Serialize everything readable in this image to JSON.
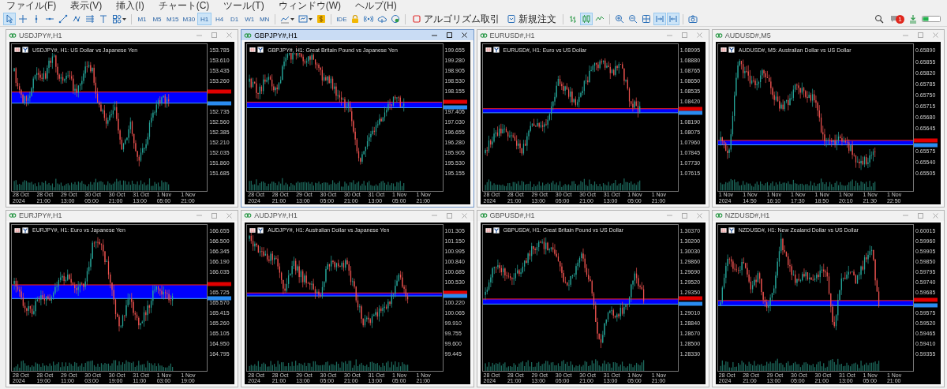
{
  "menu": [
    "ファイル(F)",
    "表示(V)",
    "挿入(I)",
    "チャート(C)",
    "ツール(T)",
    "ウィンドウ(W)",
    "ヘルプ(H)"
  ],
  "toolbar": {
    "drawing_tools": [
      {
        "kind": "cursor",
        "selected": true
      },
      {
        "kind": "crosshair",
        "selected": false
      },
      {
        "kind": "vertical-line",
        "selected": false
      },
      {
        "kind": "horizontal-line",
        "selected": false
      },
      {
        "kind": "trendline",
        "selected": false
      },
      {
        "kind": "polyline",
        "selected": false
      },
      {
        "kind": "channel",
        "selected": false
      },
      {
        "kind": "text",
        "selected": false
      },
      {
        "kind": "shapes",
        "selected": false
      }
    ],
    "timeframes": [
      {
        "label": "M1",
        "selected": false
      },
      {
        "label": "M5",
        "selected": false
      },
      {
        "label": "M15",
        "selected": false
      },
      {
        "label": "M30",
        "selected": false
      },
      {
        "label": "H1",
        "selected": true
      },
      {
        "label": "H4",
        "selected": false
      },
      {
        "label": "D1",
        "selected": false
      },
      {
        "label": "W1",
        "selected": false
      },
      {
        "label": "MN",
        "selected": false
      }
    ],
    "indicator_tools": [
      {
        "kind": "indicators"
      },
      {
        "kind": "templates"
      },
      {
        "kind": "dollar"
      }
    ],
    "ide_button": "IDE",
    "service_tools": [
      {
        "kind": "lock"
      },
      {
        "kind": "signal"
      },
      {
        "kind": "cloud"
      },
      {
        "kind": "vps"
      }
    ],
    "algo_trading_button": "アルゴリズム取引",
    "new_order_button": "新規注文",
    "chart_tools": [
      {
        "kind": "bars",
        "selected": false
      },
      {
        "kind": "candles",
        "selected": true
      },
      {
        "kind": "line",
        "selected": false
      },
      {
        "kind": "zoom-in",
        "selected": false
      },
      {
        "kind": "zoom-out",
        "selected": false
      },
      {
        "kind": "tile",
        "selected": false
      },
      {
        "kind": "autoscroll",
        "selected": true
      },
      {
        "kind": "chart-shift",
        "selected": true
      },
      {
        "kind": "screenshot",
        "selected": false
      }
    ],
    "notification_count": "1"
  },
  "charts": [
    {
      "title": "USDJPY#,H1",
      "selected": false,
      "header": "USDJPY#, H1: US Dollar vs Japanese Yen",
      "price_labels": [
        "153.785",
        "153.610",
        "153.435",
        "153.260",
        "152.735",
        "152.560",
        "152.385",
        "152.210",
        "152.035",
        "151.860",
        "151.685"
      ],
      "time_labels": [
        "28 Oct 2024",
        "28 Oct 21:00",
        "29 Oct 13:00",
        "30 Oct 05:00",
        "30 Oct 21:00",
        "31 Oct 13:00",
        "1 Nov 05:00",
        "1 Nov 21:00"
      ]
    },
    {
      "title": "GBPJPY#,H1",
      "selected": true,
      "header": "GBPJPY#, H1: Great Britain Pound vs Japanese Yen",
      "price_labels": [
        "199.655",
        "199.280",
        "198.905",
        "198.530",
        "198.155",
        "197.405",
        "197.030",
        "196.655",
        "196.280",
        "195.905",
        "195.530",
        "195.155"
      ],
      "time_labels": [
        "28 Oct 2024",
        "28 Oct 21:00",
        "29 Oct 13:00",
        "30 Oct 05:00",
        "30 Oct 21:00",
        "31 Oct 13:00",
        "1 Nov 05:00",
        "1 Nov 21:00"
      ]
    },
    {
      "title": "EURUSD#,H1",
      "selected": false,
      "header": "EURUSD#, H1: Euro vs US Dollar",
      "price_labels": [
        "1.08995",
        "1.08880",
        "1.08765",
        "1.08650",
        "1.08535",
        "1.08420",
        "1.08190",
        "1.08075",
        "1.07960",
        "1.07845",
        "1.07730",
        "1.07615"
      ],
      "time_labels": [
        "28 Oct 2024",
        "28 Oct 21:00",
        "29 Oct 13:00",
        "30 Oct 05:00",
        "30 Oct 21:00",
        "31 Oct 13:00",
        "1 Nov 05:00",
        "1 Nov 21:00"
      ]
    },
    {
      "title": "AUDUSD#,M5",
      "selected": false,
      "header": "AUDUSD#, M5: Australian Dollar vs US Dollar",
      "price_labels": [
        "0.65890",
        "0.65855",
        "0.65820",
        "0.65785",
        "0.65750",
        "0.65715",
        "0.65680",
        "0.65645",
        "0.65575",
        "0.65540",
        "0.65505"
      ],
      "time_labels": [
        "1 Nov 2024",
        "1 Nov 14:50",
        "1 Nov 16:10",
        "1 Nov 17:30",
        "1 Nov 18:50",
        "1 Nov 20:10",
        "1 Nov 21:30",
        "1 Nov 22:50"
      ]
    },
    {
      "title": "EURJPY#,H1",
      "selected": false,
      "header": "EURJPY#, H1: Euro vs Japanese Yen",
      "price_labels": [
        "166.655",
        "166.500",
        "166.345",
        "166.190",
        "166.035",
        "165.725",
        "165.570",
        "165.415",
        "165.260",
        "165.105",
        "164.950",
        "164.795"
      ],
      "time_labels": [
        "28 Oct 2024",
        "28 Oct 19:00",
        "29 Oct 11:00",
        "30 Oct 03:00",
        "30 Oct 19:00",
        "31 Oct 11:00",
        "1 Nov 03:00",
        "1 Nov 19:00"
      ]
    },
    {
      "title": "AUDJPY#,H1",
      "selected": false,
      "header": "AUDJPY#, H1: Australian Dollar vs Japanese Yen",
      "price_labels": [
        "101.305",
        "101.150",
        "100.995",
        "100.840",
        "100.685",
        "100.530",
        "100.220",
        "100.065",
        "99.910",
        "99.755",
        "99.600",
        "99.445"
      ],
      "time_labels": [
        "28 Oct 2024",
        "28 Oct 21:00",
        "29 Oct 13:00",
        "30 Oct 05:00",
        "30 Oct 21:00",
        "31 Oct 13:00",
        "1 Nov 05:00",
        "1 Nov 21:00"
      ]
    },
    {
      "title": "GBPUSD#,H1",
      "selected": false,
      "header": "GBPUSD#, H1: Great Britain Pound vs US Dollar",
      "price_labels": [
        "1.30370",
        "1.30200",
        "1.30030",
        "1.29860",
        "1.29690",
        "1.29520",
        "1.29350",
        "1.29010",
        "1.28840",
        "1.28670",
        "1.28500",
        "1.28330"
      ],
      "time_labels": [
        "28 Oct 2024",
        "28 Oct 21:00",
        "29 Oct 13:00",
        "30 Oct 05:00",
        "30 Oct 21:00",
        "31 Oct 13:00",
        "1 Nov 05:00",
        "1 Nov 21:00"
      ]
    },
    {
      "title": "NZDUSD#,H1",
      "selected": false,
      "header": "NZDUSD#, H1: New Zealand Dollar vs US Dollar",
      "price_labels": [
        "0.60015",
        "0.59960",
        "0.59905",
        "0.59850",
        "0.59795",
        "0.59740",
        "0.59685",
        "0.59575",
        "0.59520",
        "0.59465",
        "0.59410",
        "0.59355"
      ],
      "time_labels": [
        "28 Oct 2024",
        "28 Oct 21:00",
        "29 Oct 13:00",
        "30 Oct 05:00",
        "30 Oct 21:00",
        "31 Oct 13:00",
        "1 Nov 05:00",
        "1 Nov 21:00"
      ]
    }
  ]
}
